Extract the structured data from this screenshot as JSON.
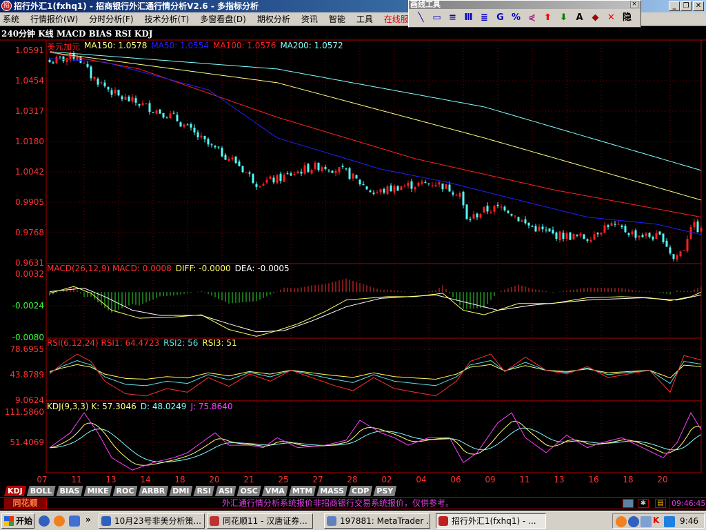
{
  "window": {
    "title": "招行外汇1(fxhq1) - 招商银行外汇通行情分析V2.6 - 多指标分析",
    "minimize": "_",
    "restore": "❐",
    "close": "✕"
  },
  "menu": [
    "系统",
    "行情报价(W)",
    "分时分析(F)",
    "技术分析(T)",
    "多窗看盘(D)",
    "期权分析",
    "资讯",
    "智能",
    "工具",
    "在线服"
  ],
  "drawing_toolbar": {
    "title": "画线工具",
    "close": "×",
    "tools": [
      {
        "name": "line-tool",
        "glyph": "╲",
        "color": "#0000c0"
      },
      {
        "name": "rectangle-tool",
        "glyph": "▭",
        "color": "#0000c0"
      },
      {
        "name": "parallel-lines-tool",
        "glyph": "≡",
        "color": "#0000c0"
      },
      {
        "name": "gann-t-tool",
        "glyph": "Ⅲ",
        "color": "#0000c0"
      },
      {
        "name": "gann-grid-tool",
        "glyph": "≣",
        "color": "#0000c0"
      },
      {
        "name": "gann-g-tool",
        "glyph": "G",
        "color": "#0000c0"
      },
      {
        "name": "percent-tool",
        "glyph": "%",
        "color": "#0000c0"
      },
      {
        "name": "fan-tool",
        "glyph": "⋞",
        "color": "#a02080"
      },
      {
        "name": "up-arrow-tool",
        "glyph": "⬆",
        "color": "#ff0000"
      },
      {
        "name": "down-arrow-tool",
        "glyph": "⬇",
        "color": "#008000"
      },
      {
        "name": "text-tool",
        "glyph": "A",
        "color": "#000000"
      },
      {
        "name": "eraser-tool",
        "glyph": "◆",
        "color": "#a00000"
      },
      {
        "name": "delete-tool",
        "glyph": "✕",
        "color": "#ff0000"
      },
      {
        "name": "hide-tool",
        "glyph": "隐",
        "color": "#000000"
      }
    ]
  },
  "chart": {
    "header": "240分钟 K线 MACD BIAS RSI KDJ",
    "symbol": "美元加元",
    "ma_legend": [
      {
        "label": "MA150: 1.0578",
        "color": "#ffff80"
      },
      {
        "label": "MA50: 1.0554",
        "color": "#2020ff"
      },
      {
        "label": "MA100: 1.0576",
        "color": "#ff2020"
      },
      {
        "label": "MA200: 1.0572",
        "color": "#80ffff"
      }
    ],
    "macd_legend": [
      {
        "label": "MACD(26,12,9) MACD: 0.0008",
        "color": "#ff3030"
      },
      {
        "label": "DIFF: -0.0000",
        "color": "#ffff60"
      },
      {
        "label": "DEA: -0.0005",
        "color": "#ffffff"
      }
    ],
    "rsi_legend": [
      {
        "label": "RSI(6,12,24) RSI1: 64.4723",
        "color": "#ff3030"
      },
      {
        "label": "RSI2: 56",
        "color": "#60e0e0"
      },
      {
        "label": "RSI3: 51",
        "color": "#ffff60"
      }
    ],
    "kdj_legend": [
      {
        "label": "KDJ(9,3,3) K: 57.3046",
        "color": "#ffff80"
      },
      {
        "label": "D: 48.0249",
        "color": "#80ffff"
      },
      {
        "label": "J: 75.8640",
        "color": "#ff40ff"
      }
    ]
  },
  "chart_data": {
    "type": "candlestick",
    "bars": 190,
    "up_color": "#ff2020",
    "down_color": "#54fcfc",
    "price_ticks": [
      "1.0591",
      "1.0454",
      "1.0317",
      "1.0180",
      "1.0042",
      "0.9905",
      "0.9768",
      "0.9631"
    ],
    "price_range": [
      0.9631,
      1.0591
    ],
    "close_keypoints": [
      [
        0,
        1.0538
      ],
      [
        8,
        1.0569
      ],
      [
        12,
        1.0476
      ],
      [
        20,
        1.0382
      ],
      [
        26,
        1.0351
      ],
      [
        36,
        1.0289
      ],
      [
        46,
        1.0164
      ],
      [
        54,
        1.0087
      ],
      [
        60,
        0.9993
      ],
      [
        66,
        1.0009
      ],
      [
        74,
        1.0055
      ],
      [
        79,
        1.0071
      ],
      [
        86,
        1.004
      ],
      [
        94,
        0.9946
      ],
      [
        102,
        0.9978
      ],
      [
        112,
        0.9993
      ],
      [
        119,
        0.9946
      ],
      [
        121,
        0.9822
      ],
      [
        126,
        0.9868
      ],
      [
        132,
        0.9884
      ],
      [
        138,
        0.9806
      ],
      [
        146,
        0.9759
      ],
      [
        156,
        0.9744
      ],
      [
        162,
        0.9806
      ],
      [
        170,
        0.9759
      ],
      [
        178,
        0.9744
      ],
      [
        181,
        0.965
      ],
      [
        184,
        0.9697
      ],
      [
        186,
        0.9806
      ],
      [
        189,
        0.9775
      ]
    ],
    "ma": [
      {
        "name": "MA200",
        "color": "#80ffff",
        "points": [
          [
            0,
            1.0585
          ],
          [
            66,
            1.0507
          ],
          [
            126,
            1.0336
          ],
          [
            189,
            1.0049
          ]
        ]
      },
      {
        "name": "MA150",
        "color": "#ffff80",
        "points": [
          [
            0,
            1.0582
          ],
          [
            66,
            1.0445
          ],
          [
            126,
            1.0196
          ],
          [
            189,
            0.9915
          ]
        ]
      },
      {
        "name": "MA100",
        "color": "#ff2020",
        "points": [
          [
            0,
            1.0582
          ],
          [
            26,
            1.0507
          ],
          [
            66,
            1.0289
          ],
          [
            106,
            1.0102
          ],
          [
            146,
            0.9962
          ],
          [
            189,
            0.9838
          ]
        ]
      },
      {
        "name": "MA50",
        "color": "#2020ff",
        "points": [
          [
            0,
            1.0554
          ],
          [
            16,
            1.0538
          ],
          [
            46,
            1.0413
          ],
          [
            66,
            1.0196
          ],
          [
            96,
            1.0055
          ],
          [
            116,
            0.9993
          ],
          [
            136,
            0.9915
          ],
          [
            156,
            0.9838
          ],
          [
            176,
            0.9806
          ],
          [
            189,
            0.9759
          ]
        ]
      }
    ],
    "macd_ticks": [
      "0.0032",
      "-0.0024",
      "-0.0080"
    ],
    "macd_range": [
      -0.008,
      0.0032
    ],
    "diff": [
      [
        0,
        -0.0002
      ],
      [
        7,
        0.001
      ],
      [
        12,
        -0.0002
      ],
      [
        18,
        -0.0032
      ],
      [
        26,
        -0.0046
      ],
      [
        36,
        -0.0044
      ],
      [
        44,
        -0.004
      ],
      [
        52,
        -0.0066
      ],
      [
        60,
        -0.0078
      ],
      [
        66,
        -0.0068
      ],
      [
        72,
        -0.0056
      ],
      [
        80,
        -0.0034
      ],
      [
        86,
        -0.0014
      ],
      [
        92,
        -0.0011
      ],
      [
        98,
        -0.0008
      ],
      [
        106,
        -0.0008
      ],
      [
        114,
        -0.0002
      ],
      [
        120,
        -0.0032
      ],
      [
        126,
        -0.004
      ],
      [
        136,
        -0.002
      ],
      [
        146,
        -0.002
      ],
      [
        156,
        -0.001
      ],
      [
        166,
        -0.0008
      ],
      [
        174,
        -0.001
      ],
      [
        180,
        -0.0015
      ],
      [
        186,
        -0.0008
      ],
      [
        189,
        0.0
      ]
    ],
    "dea": [
      [
        0,
        0.0001
      ],
      [
        10,
        0.0007
      ],
      [
        16,
        -0.0008
      ],
      [
        24,
        -0.0032
      ],
      [
        32,
        -0.0041
      ],
      [
        44,
        -0.0041
      ],
      [
        52,
        -0.0056
      ],
      [
        60,
        -0.007
      ],
      [
        68,
        -0.0068
      ],
      [
        76,
        -0.0051
      ],
      [
        86,
        -0.0026
      ],
      [
        96,
        -0.0011
      ],
      [
        112,
        -0.0005
      ],
      [
        122,
        -0.002
      ],
      [
        130,
        -0.0032
      ],
      [
        140,
        -0.0023
      ],
      [
        156,
        -0.0014
      ],
      [
        172,
        -0.001
      ],
      [
        182,
        -0.0014
      ],
      [
        189,
        -0.0005
      ]
    ],
    "rsi_ticks": [
      "78.6955",
      "43.8789",
      "9.0624"
    ],
    "rsi_range": [
      9.0624,
      78.6955
    ],
    "rsi1": [
      [
        0,
        45
      ],
      [
        4,
        60
      ],
      [
        8,
        72
      ],
      [
        12,
        62
      ],
      [
        16,
        35
      ],
      [
        22,
        18
      ],
      [
        28,
        15
      ],
      [
        34,
        25
      ],
      [
        40,
        20
      ],
      [
        46,
        40
      ],
      [
        52,
        28
      ],
      [
        58,
        45
      ],
      [
        64,
        35
      ],
      [
        70,
        50
      ],
      [
        76,
        40
      ],
      [
        82,
        30
      ],
      [
        88,
        22
      ],
      [
        94,
        40
      ],
      [
        100,
        25
      ],
      [
        106,
        20
      ],
      [
        112,
        15
      ],
      [
        118,
        35
      ],
      [
        122,
        62
      ],
      [
        128,
        72
      ],
      [
        132,
        48
      ],
      [
        138,
        68
      ],
      [
        144,
        50
      ],
      [
        150,
        45
      ],
      [
        156,
        55
      ],
      [
        162,
        40
      ],
      [
        168,
        45
      ],
      [
        174,
        50
      ],
      [
        180,
        20
      ],
      [
        184,
        70
      ],
      [
        189,
        64
      ]
    ],
    "kdj_ticks": [
      "111.5860",
      "51.4069"
    ],
    "kdj_range": [
      -8.8,
      111.586
    ],
    "j": [
      [
        0,
        40
      ],
      [
        6,
        70
      ],
      [
        10,
        110
      ],
      [
        14,
        70
      ],
      [
        18,
        20
      ],
      [
        24,
        -5
      ],
      [
        30,
        10
      ],
      [
        36,
        20
      ],
      [
        40,
        30
      ],
      [
        44,
        50
      ],
      [
        48,
        70
      ],
      [
        52,
        45
      ],
      [
        58,
        45
      ],
      [
        62,
        40
      ],
      [
        66,
        60
      ],
      [
        72,
        40
      ],
      [
        80,
        45
      ],
      [
        86,
        55
      ],
      [
        90,
        95
      ],
      [
        96,
        70
      ],
      [
        100,
        60
      ],
      [
        104,
        45
      ],
      [
        110,
        60
      ],
      [
        116,
        60
      ],
      [
        120,
        10
      ],
      [
        124,
        30
      ],
      [
        130,
        90
      ],
      [
        134,
        110
      ],
      [
        138,
        60
      ],
      [
        144,
        30
      ],
      [
        150,
        65
      ],
      [
        156,
        40
      ],
      [
        160,
        50
      ],
      [
        166,
        60
      ],
      [
        172,
        40
      ],
      [
        178,
        20
      ],
      [
        182,
        50
      ],
      [
        186,
        110
      ],
      [
        189,
        76
      ]
    ],
    "dates": [
      "07",
      "11",
      "13",
      "14",
      "18",
      "20",
      "21",
      "25",
      "27",
      "28",
      "02",
      "04",
      "06",
      "09",
      "11",
      "13",
      "16",
      "18",
      "20"
    ]
  },
  "tabs": [
    "KDJ",
    "BOLL",
    "BIAS",
    "MIKE",
    "ROC",
    "ARBR",
    "DMI",
    "RSI",
    "ASI",
    "OSC",
    "VMA",
    "MTM",
    "MASS",
    "CDP",
    "PSY"
  ],
  "status": {
    "brand": "同花顺",
    "notice": "外汇通行情分析系统报价非招商银行交易系统报价，仅供参考。",
    "time": "09:46:45"
  },
  "taskbar": {
    "start": "开始",
    "more": "»",
    "tasks": [
      {
        "label": "10月23号非美分析策...",
        "color": "#3060c0"
      },
      {
        "label": "同花顺11 - 汉唐证券...",
        "color": "#c03030"
      },
      {
        "label": "197881: MetaTrader ...",
        "color": "#6080c0"
      },
      {
        "label": "招行外汇1(fxhq1) - ...",
        "color": "#c02020"
      }
    ],
    "clock": "9:46"
  }
}
